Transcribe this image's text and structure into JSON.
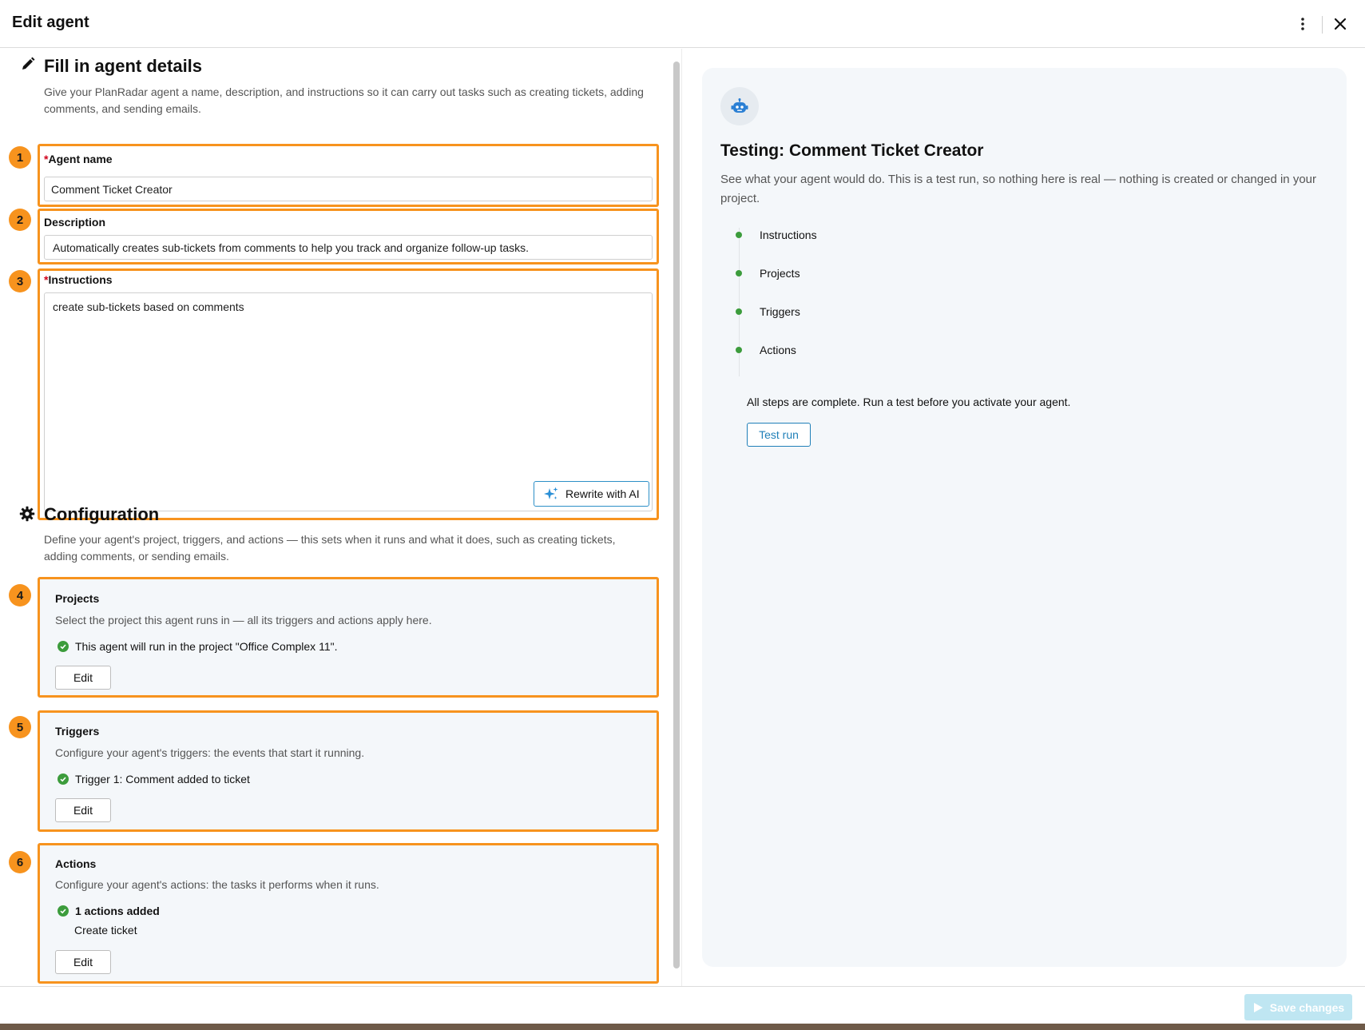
{
  "header": {
    "title": "Edit agent"
  },
  "details": {
    "title": "Fill in agent details",
    "description": "Give your PlanRadar agent a name, description, and instructions so it can carry out tasks such as creating tickets, adding comments, and sending emails."
  },
  "fields": {
    "agent_name": {
      "number": "1",
      "required_mark": "*",
      "label": "Agent name",
      "value": "Comment Ticket Creator"
    },
    "description": {
      "number": "2",
      "label": "Description",
      "value": "Automatically creates sub-tickets from comments to help you track and organize follow-up tasks."
    },
    "instructions": {
      "number": "3",
      "required_mark": "*",
      "label": "Instructions",
      "value": "create sub-tickets based on comments",
      "ai_button": "Rewrite with AI"
    }
  },
  "configuration": {
    "title": "Configuration",
    "description": "Define your agent's project, triggers, and actions — this sets when it runs and what it does, such as creating tickets, adding comments, or sending emails.",
    "projects": {
      "number": "4",
      "title": "Projects",
      "description": "Select the project this agent runs in — all its triggers and actions apply here.",
      "status": "This agent will run in the project \"Office Complex 11\".",
      "edit_label": "Edit"
    },
    "triggers": {
      "number": "5",
      "title": "Triggers",
      "description": "Configure your agent's triggers: the events that start it running.",
      "status": "Trigger 1: Comment added to ticket",
      "edit_label": "Edit"
    },
    "actions": {
      "number": "6",
      "title": "Actions",
      "description": "Configure your agent's actions: the tasks it performs when it runs.",
      "status": "1 actions added",
      "detail": "Create ticket",
      "edit_label": "Edit"
    }
  },
  "testing": {
    "icon": "robot-icon",
    "title": "Testing: Comment Ticket Creator",
    "description": "See what your agent would do. This is a test run, so nothing here is real — nothing is created or changed in your project.",
    "steps": [
      "Instructions",
      "Projects",
      "Triggers",
      "Actions"
    ],
    "complete_text": "All steps are complete. Run a test before you activate your agent.",
    "test_button": "Test run"
  },
  "footer": {
    "save_label": "Save changes"
  },
  "colors": {
    "highlight": "#f7931e",
    "success": "#3c9c3c",
    "link": "#1f7fb8",
    "save_disabled": "#bfe6f2"
  }
}
